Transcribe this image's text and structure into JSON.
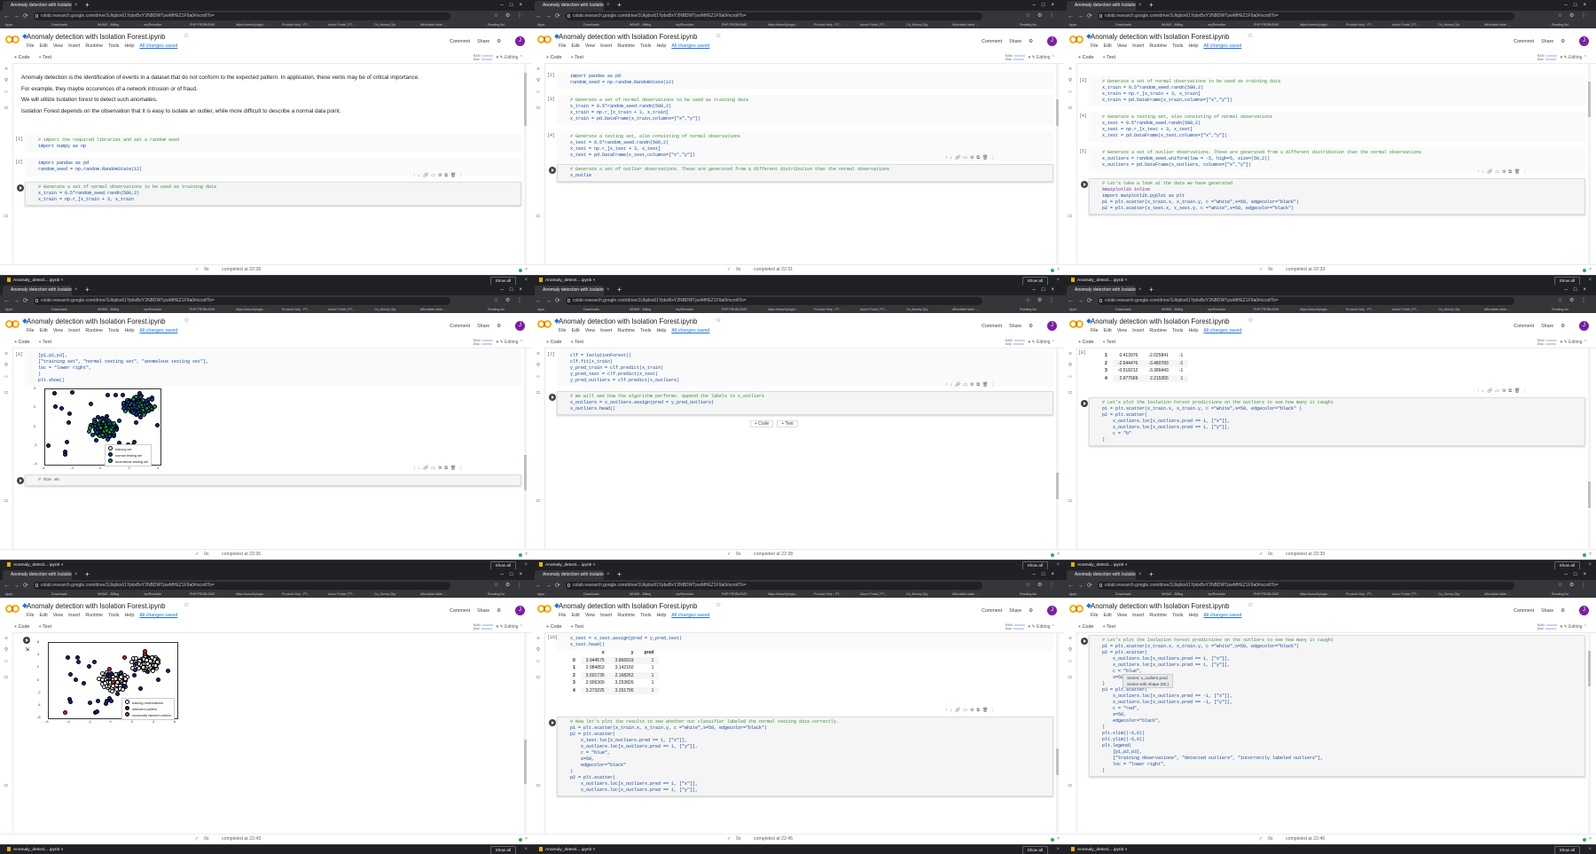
{
  "tab_title": "Anomaly detection with Isolation Forest.ipynb",
  "notebook_title": "Anomaly detection with Isolation Forest.ipynb",
  "url": "colab.research.google.com/drive/1Ukjdxx61YpbxBxY2NBDWTpwMHEZ1F9a0#scrollTo=",
  "bookmarks": [
    "Apps",
    "Downloads",
    "WHMS - Billing",
    "my/Recruiter",
    "PHP PROBLEMS",
    "https://www.flyingto...",
    "Product Help - PT...",
    "Azure Portal | PT...",
    "Ca_Money Qiq",
    "Affordable table ...",
    "Reading list"
  ],
  "menu": {
    "file": "File",
    "edit": "Edit",
    "view": "View",
    "insert": "Insert",
    "runtime": "Runtime",
    "tools": "Tools",
    "help": "Help",
    "saved": "All changes saved"
  },
  "header": {
    "comment": "Comment",
    "share": "Share",
    "avatar": "J"
  },
  "toolbar": {
    "code": "+ Code",
    "text": "+ Text",
    "ram": "RAM",
    "disk": "Disk",
    "editing": "Editing"
  },
  "download": {
    "file": "Anomaly_detecti....ipynb",
    "show_all": "Show all"
  },
  "panels": [
    {
      "status": "completed at 22:28",
      "text_paras": [
        "Anomaly detection is the identification of events in a dataset that do not conform to the expected pattern. In application, these vents may be of critical importance.",
        "For example, they maybe occurences of a network intrusion or of fraud.",
        "We will utilize Isolation forest to detect such anomalies.",
        "Isolation Forest depends on the observation that it is easy to isolate an outlier, while more difficult to describe a normal data point."
      ],
      "cells": [
        {
          "prompt": "[1]",
          "lines": [
            {
              "t": "c",
              "s": "# import the required libraries and set a random seed"
            },
            {
              "t": "",
              "s": "import numpy as np"
            }
          ]
        },
        {
          "prompt": "[2]",
          "lines": [
            {
              "t": "",
              "s": "import pandas as pd"
            },
            {
              "t": "",
              "s": "random_seed = np.random.RandomState(12)"
            }
          ]
        },
        {
          "prompt": "",
          "lines": [
            {
              "t": "c",
              "s": "# Generate a set of normal observations to be used as training data"
            },
            {
              "t": "",
              "s": "x_train = 0.5*random_seed.randn(500,2)"
            },
            {
              "t": "",
              "s": "x_train = np.r_[x_train + 3, x_train"
            }
          ]
        }
      ]
    },
    {
      "status": "completed at 22:31",
      "cells": [
        {
          "prompt": "[2]",
          "lines": [
            {
              "t": "",
              "s": "import pandas as pd"
            },
            {
              "t": "",
              "s": "random_seed = np.random.RandomState(12)"
            }
          ]
        },
        {
          "prompt": "[3]",
          "lines": [
            {
              "t": "c",
              "s": "# Generate a set of normal observations to be used as training data"
            },
            {
              "t": "",
              "s": "x_train = 0.5*random_seed.randn(500,2)"
            },
            {
              "t": "",
              "s": "x_train = np.r_[x_train + 3, x_train]"
            },
            {
              "t": "",
              "s": "x_train = pd.DataFrame(x_train,columns=[\"x\",\"y\"])"
            }
          ]
        },
        {
          "prompt": "[4]",
          "lines": [
            {
              "t": "c",
              "s": "# Generate a testing set, also consisting of normal observations"
            },
            {
              "t": "",
              "s": "x_test = 0.5*random_seed.randn(500,2)"
            },
            {
              "t": "",
              "s": "x_test = np.r_[x_test + 3, x_test]"
            },
            {
              "t": "",
              "s": "x_test = pd.DataFrame(x_test,columns=[\"x\",\"y\"])"
            }
          ]
        },
        {
          "prompt": "",
          "lines": [
            {
              "t": "c",
              "s": "# Generate a set of outlier observations. These are generated from a different distribution than the normal observations"
            },
            {
              "t": "",
              "s": "x_outlie"
            }
          ]
        }
      ]
    },
    {
      "status": "completed at 22:33",
      "cells": [
        {
          "prompt": "[3]",
          "lines": [
            {
              "t": "c",
              "s": "# Generate a set of normal observations to be used as training data"
            },
            {
              "t": "",
              "s": "x_train = 0.5*random_seed.randn(500,2)"
            },
            {
              "t": "",
              "s": "x_train = np.r_[x_train + 3, x_train]"
            },
            {
              "t": "",
              "s": "x_train = pd.DataFrame(x_train,columns=[\"x\",\"y\"])"
            }
          ]
        },
        {
          "prompt": "[4]",
          "lines": [
            {
              "t": "c",
              "s": "# Generate a testing set, also consisting of normal observations"
            },
            {
              "t": "",
              "s": "x_test = 0.5*random_seed.randn(500,2)"
            },
            {
              "t": "",
              "s": "x_test = np.r_[x_test + 3, x_test]"
            },
            {
              "t": "",
              "s": "x_test = pd.DataFrame(x_test,columns=[\"x\",\"y\"])"
            }
          ]
        },
        {
          "prompt": "[5]",
          "lines": [
            {
              "t": "c",
              "s": "# Generate a set of outlier observations. These are generated from a different distribution than the normal observations"
            },
            {
              "t": "",
              "s": "x_outliers = random_seed.uniform(low = -5, high=5, size=(50,2))"
            },
            {
              "t": "",
              "s": "x_outliers = pd.DataFrame(x_outliers, columns=[\"x\",\"y\"])"
            }
          ]
        },
        {
          "prompt": "",
          "lines": [
            {
              "t": "c",
              "s": "# Let's take a look at the data we have generated"
            },
            {
              "t": "k",
              "s": "%matplotlib inline"
            },
            {
              "t": "",
              "s": "import matplotlib.pyplot as plt"
            },
            {
              "t": "",
              "s": ""
            },
            {
              "t": "",
              "s": "p1 = plt.scatter(x_train.x, x_train.y, c =\"white\",s=50, edgecolor=\"black\")"
            },
            {
              "t": "",
              "s": "p2 = plt.scatter(x_test.x, x_test.y, c =\"white\",s=50, edgecolor=\"black\")"
            }
          ]
        }
      ]
    },
    {
      "status": "completed at 22:36",
      "cells": [
        {
          "prompt": "[6]",
          "lines": [
            {
              "t": "",
              "s": "[p1,p2,p3],"
            },
            {
              "t": "",
              "s": "[\"training set\", \"normal testing set\", \"anomalous testing set\"],"
            },
            {
              "t": "",
              "s": "loc = \"lower right\","
            },
            {
              "t": "",
              "s": ")"
            },
            {
              "t": "",
              "s": "plt.show()"
            }
          ]
        },
        {
          "prompt": "",
          "lines": [
            {
              "t": "c",
              "s": "# Now we"
            }
          ]
        }
      ],
      "plot": {
        "legend": [
          "training set",
          "normal testing set",
          "anomalous testing set"
        ],
        "xticks": [
          "-4",
          "-2",
          "0",
          "2",
          "4"
        ],
        "yticks": [
          "4",
          "2",
          "0",
          "-2",
          "-4"
        ]
      }
    },
    {
      "status": "completed at 22:38",
      "cells": [
        {
          "prompt": "[7]",
          "lines": [
            {
              "t": "",
              "s": "clf = IsolationForest()"
            },
            {
              "t": "",
              "s": "clf.fit(x_train)"
            },
            {
              "t": "",
              "s": "y_pred_train = clf.predict(x_train)"
            },
            {
              "t": "",
              "s": "y_pred_test = clf.predict(x_test)"
            },
            {
              "t": "",
              "s": "y_pred_outliers = clf.predict(x_outliers)"
            }
          ]
        },
        {
          "prompt": "",
          "lines": [
            {
              "t": "c",
              "s": "# We will see how the algorithm performs. Append the labels to x_outliers"
            },
            {
              "t": "",
              "s": "x_outliers = x_outliers.assign(pred = y_pred_outliers)"
            },
            {
              "t": "",
              "s": "x_outliers.head()"
            }
          ]
        }
      ],
      "addcell": {
        "code": "+ Code",
        "text": "+ Text"
      }
    },
    {
      "status": "completed at 22:39",
      "table": {
        "rows": [
          [
            "1",
            "0.413976",
            "-2.025841",
            "-1"
          ],
          [
            "2",
            "-2.644476",
            "-3.480783",
            "-1"
          ],
          [
            "3",
            "-0.518212",
            "-3.386443",
            "-1"
          ],
          [
            "4",
            "2.977669",
            "2.215355",
            "1"
          ]
        ]
      },
      "cells": [
        {
          "prompt": "",
          "lines": [
            {
              "t": "c",
              "s": "# Let's plot the Isolation Forest predictions on the outliers to see how many it caught"
            },
            {
              "t": "",
              "s": "p1 = plt.scatter(x_train.x, x_train.y, c =\"white\",s=50, edgecolor=\"black\" )"
            },
            {
              "t": "",
              "s": "p2 = plt.scatter("
            },
            {
              "t": "",
              "s": "    x_outliers.loc[x_outliers.pred == 1, [\"x\"]],"
            },
            {
              "t": "",
              "s": "    x_outliers.loc[x_outliers.pred == 1, [\"y\"]],"
            },
            {
              "t": "",
              "s": "    c = \"b\""
            },
            {
              "t": "",
              "s": ")"
            }
          ]
        }
      ]
    },
    {
      "status": "completed at 22:43",
      "plot": {
        "legend": [
          "training observations",
          "detected outliers",
          "incorrectly labeled outliers"
        ],
        "xticks": [
          "-6",
          "-4",
          "-2",
          "0",
          "2",
          "4",
          "6"
        ],
        "yticks": [
          "6",
          "4",
          "2",
          "0",
          "-2",
          "-4",
          "-6"
        ]
      }
    },
    {
      "status": "completed at 22:45",
      "cells": [
        {
          "prompt": "[10]",
          "lines": [
            {
              "t": "",
              "s": "x_test = x_test.assign(pred = y_pred_test)"
            },
            {
              "t": "",
              "s": "x_test.head()"
            }
          ]
        },
        {
          "prompt": "",
          "lines": [
            {
              "t": "c",
              "s": "# Now let's plot the results to see whether our classifier labeled the normal testing data correctly."
            },
            {
              "t": "",
              "s": "p1 = plt.scatter(x_train.x, x_train.y, c =\"white\",s=50, edgecolor=\"black\")"
            },
            {
              "t": "",
              "s": "p2 = plt.scatter("
            },
            {
              "t": "",
              "s": "    x_test.loc[x_outliers.pred == 1, [\"x\"]],"
            },
            {
              "t": "",
              "s": "    x_outliers.loc[x_outliers.pred == 1, [\"y\"]],"
            },
            {
              "t": "",
              "s": "    c = \"blue\","
            },
            {
              "t": "",
              "s": "    s=50,"
            },
            {
              "t": "",
              "s": "    edgecolor=\"black\""
            },
            {
              "t": "",
              "s": ")"
            },
            {
              "t": "",
              "s": "p2 = plt.scatter("
            },
            {
              "t": "",
              "s": "    x_outliers.loc[x_outliers.pred == 1, [\"x\"]],"
            },
            {
              "t": "",
              "s": "    x_outliers.loc[x_outliers.pred == 1, [\"y\"]],"
            }
          ]
        }
      ],
      "table": {
        "header": [
          "",
          "x",
          "y",
          "pred"
        ],
        "rows": [
          [
            "0",
            "3.944575",
            "3.866919",
            "1"
          ],
          [
            "1",
            "2.984853",
            "3.142150",
            "1"
          ],
          [
            "2",
            "3.501735",
            "2.168262",
            "1"
          ],
          [
            "3",
            "2.906300",
            "3.253826",
            "1"
          ],
          [
            "4",
            "3.273225",
            "3.261790",
            "1"
          ]
        ]
      }
    },
    {
      "status": "completed at 22:46",
      "cells": [
        {
          "prompt": "",
          "lines": [
            {
              "t": "c",
              "s": "# Let's plot the Isolation Forest predictions on the outliers to see how many it caught"
            },
            {
              "t": "",
              "s": "p1 = plt.scatter(x_train.x, x_train.y, c =\"white\",s=50, edgecolor=\"black\")"
            },
            {
              "t": "",
              "s": "p2 = plt.scatter("
            },
            {
              "t": "",
              "s": "    x_outliers.loc[x_outliers.pred == 1, [\"x\"]],"
            },
            {
              "t": "",
              "s": "    x_outliers.loc[x_outliers.pred == 1, [\"y\"]],"
            },
            {
              "t": "",
              "s": "    c = \"blue\","
            },
            {
              "t": "",
              "s": "    s=50,"
            },
            {
              "t": "",
              "s": ")"
            },
            {
              "t": "",
              "s": "p3 = plt.scatter("
            },
            {
              "t": "",
              "s": "    x_outliers.loc[x_outliers.pred == -1, [\"x\"]],"
            },
            {
              "t": "",
              "s": "    x_outliers.loc[x_outliers.pred == -1, [\"y\"]],"
            },
            {
              "t": "",
              "s": "    c = \"red\","
            },
            {
              "t": "",
              "s": "    s=50,"
            },
            {
              "t": "",
              "s": "    edgecolor=\"black\","
            },
            {
              "t": "",
              "s": ")"
            },
            {
              "t": "",
              "s": ""
            },
            {
              "t": "",
              "s": "plt.xlim((-6,6))"
            },
            {
              "t": "",
              "s": "plt.ylim((-6,6))"
            },
            {
              "t": "",
              "s": "plt.legend("
            },
            {
              "t": "",
              "s": "    [p1,p2,p3],"
            },
            {
              "t": "",
              "s": "    [\"training observations\", \"detected outliers\", \"incorrectly labeled outliers\"],"
            },
            {
              "t": "",
              "s": "    loc = \"lower right\","
            },
            {
              "t": "",
              "s": ")"
            }
          ]
        }
      ],
      "tooltip": [
        "Series: x_outliers.pred",
        "Series with shape (50,)"
      ]
    }
  ]
}
